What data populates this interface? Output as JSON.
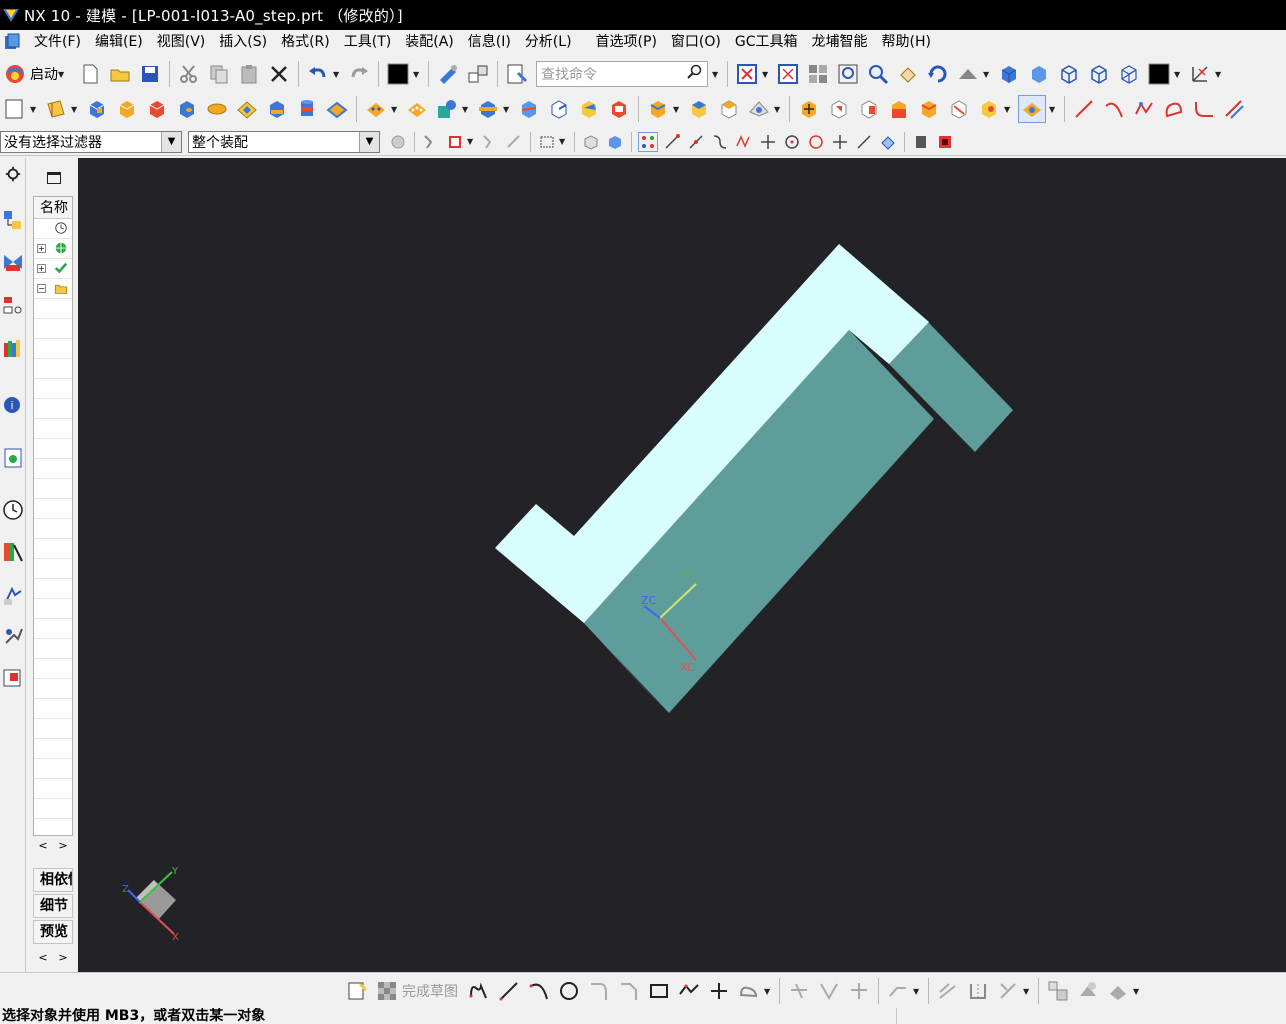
{
  "window": {
    "title": "NX 10 - 建模 - [LP-001-I013-A0_step.prt （修改的）]"
  },
  "menubar": {
    "items": [
      {
        "label": "文件(F)"
      },
      {
        "label": "编辑(E)"
      },
      {
        "label": "视图(V)"
      },
      {
        "label": "插入(S)"
      },
      {
        "label": "格式(R)"
      },
      {
        "label": "工具(T)"
      },
      {
        "label": "装配(A)"
      },
      {
        "label": "信息(I)"
      },
      {
        "label": "分析(L)"
      },
      {
        "label": "首选项(P)"
      },
      {
        "label": "窗口(O)"
      },
      {
        "label": "GC工具箱"
      },
      {
        "label": "龙埔智能"
      },
      {
        "label": "帮助(H)"
      }
    ]
  },
  "toolbar": {
    "start_label": "启动",
    "search_placeholder": "查找命令"
  },
  "selection_bar": {
    "filter_value": "没有选择过滤器",
    "scope_value": "整个装配"
  },
  "navigator": {
    "column_header": "名称",
    "sections": [
      {
        "label": "相依性"
      },
      {
        "label": "细节"
      },
      {
        "label": "预览"
      }
    ]
  },
  "viewport": {
    "background": "#232327",
    "part_top_color": "#d8fdfd",
    "part_side_color": "#5f9d9b",
    "part_dark_color": "#4f8a88",
    "csys_labels": {
      "x": "XC",
      "y": "YC",
      "z": "ZC"
    },
    "triad_labels": {
      "x": "X",
      "y": "Y",
      "z": "Z"
    }
  },
  "sketch_bar": {
    "finish_label": "完成草图"
  },
  "status": {
    "text": "选择对象并使用 MB3，或者双击某一对象"
  },
  "colors": {
    "accent_blue": "#1e6fd9",
    "axis_x": "#e05050",
    "axis_y": "#40c040",
    "axis_z": "#4060ff"
  }
}
